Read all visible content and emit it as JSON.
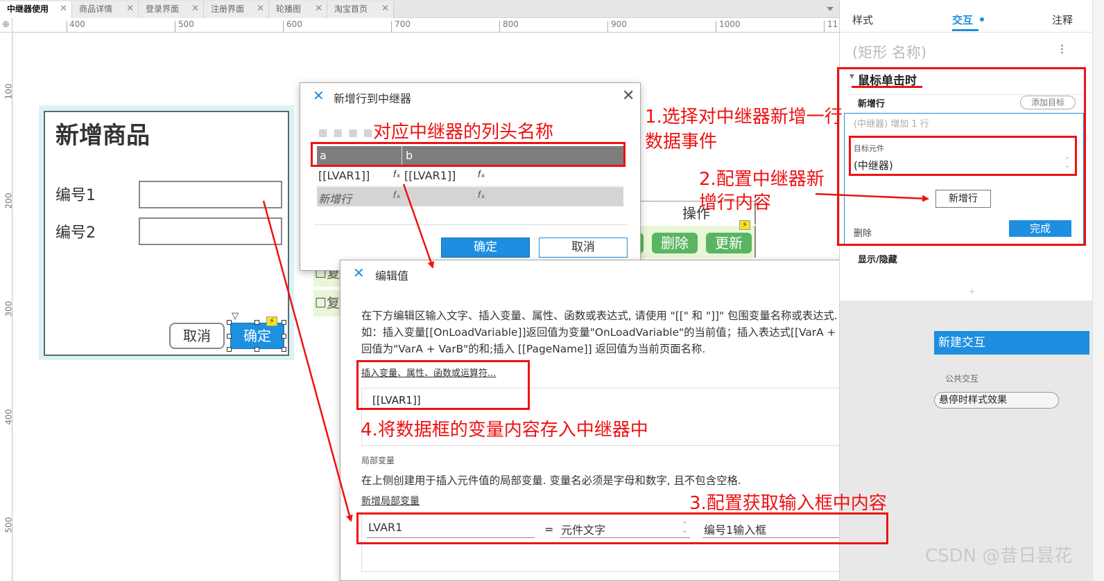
{
  "tabs": [
    {
      "label": "中继器使用",
      "close": "✕"
    },
    {
      "label": "商品详情",
      "close": "✕"
    },
    {
      "label": "登录界面",
      "close": "✕"
    },
    {
      "label": "注册界面",
      "close": "✕"
    },
    {
      "label": "轮播图",
      "close": "✕"
    },
    {
      "label": "淘宝首页",
      "close": "✕"
    }
  ],
  "ruler": {
    "corner_icon": "⊕",
    "h_labels": [
      "400",
      "500",
      "600",
      "700",
      "800",
      "900",
      "1000",
      "11"
    ],
    "v_labels": [
      "100",
      "200",
      "300",
      "400",
      "500"
    ]
  },
  "widget": {
    "title": "新增商品",
    "label1": "编号1",
    "label2": "编号2",
    "cancel": "取消",
    "ok": "确定",
    "bolt": "⚡",
    "marker": "▽"
  },
  "repeater": {
    "op_header": "操作",
    "delete": "删除",
    "update": "更新",
    "partial_buttons": [
      "",
      ""
    ],
    "checkbox_rows": [
      "☐复",
      "☐复"
    ],
    "bolt": "⚡"
  },
  "add_row_dialog": {
    "logo": "✕",
    "title": "新增行到中继器",
    "close": "✕",
    "toolbar_icons": "▦ ▦ ▦ ▦",
    "col_a": "a",
    "col_b": "b",
    "row1_a": "[[LVAR1]]",
    "row1_b": "[[LVAR1]]",
    "row2_a": "新增行",
    "fx": "𝑓ₓ",
    "ok": "确定",
    "cancel": "取消"
  },
  "edit_dialog": {
    "logo": "✕",
    "title": "编辑值",
    "close": "✕",
    "desc1": "在下方编辑区输入文字、插入变量、属性、函数或表达式, 请使用 \"[[\" 和 \"]]\" 包围变量名称或表达式. 例",
    "desc2": "如：插入变量[[OnLoadVariable]]返回值为变量\"OnLoadVariable\"的当前值；插入表达式[[VarA + VarB]]返",
    "desc3": "回值为\"VarA + VarB\"的和;插入 [[PageName]] 返回值为当前页面名称.",
    "insert_link": "插入变量、属性、函数或运算符...",
    "editor_value": "[[LVAR1]]",
    "local_var_heading": "局部变量",
    "local_var_desc": "在上侧创建用于插入元件值的局部变量. 变量名必须是字母和数字, 且不包含空格.",
    "add_local_var": "新增局部变量",
    "var_name": "LVAR1",
    "equals": "=",
    "var_type": "元件文字",
    "var_target": "编号1输入框",
    "var_delete": "✕"
  },
  "right_panel": {
    "tab_style": "样式",
    "tab_interaction": "交互",
    "tab_notes": "注释",
    "shape_name_placeholder": "(矩形 名称)",
    "settings_icon": "⫶",
    "event_name": "鼠标单击时",
    "action_name": "新增行",
    "add_target": "添加目标",
    "action_summary": "(中继器) 增加 1 行",
    "target_label": "目标元件",
    "target_value": "(中继器)",
    "add_row_button": "新增行",
    "delete": "删除",
    "done": "完成",
    "show_hide": "显示/隐藏",
    "plus": "+",
    "new_interaction": "新建交互",
    "common_interactions": "公共交互",
    "hover_style": "悬停时样式效果"
  },
  "annotations": {
    "a1_line1": "1.选择对中继器新增一行",
    "a1_line2": "数据事件",
    "a2_line1": "2.配置中继器新",
    "a2_line2": "增行内容",
    "a3": "3.配置获取输入框中内容",
    "a4": "4.将数据框的变量内容存入中继器中",
    "col_header_note": "对应中继器的列头名称"
  },
  "watermark": "CSDN @昔日昙花",
  "colors": {
    "accent": "#1e8ee0",
    "annotation": "#ee1111",
    "repeater_row": "#e9f7d7",
    "widget_select": "#d8f4f6"
  }
}
